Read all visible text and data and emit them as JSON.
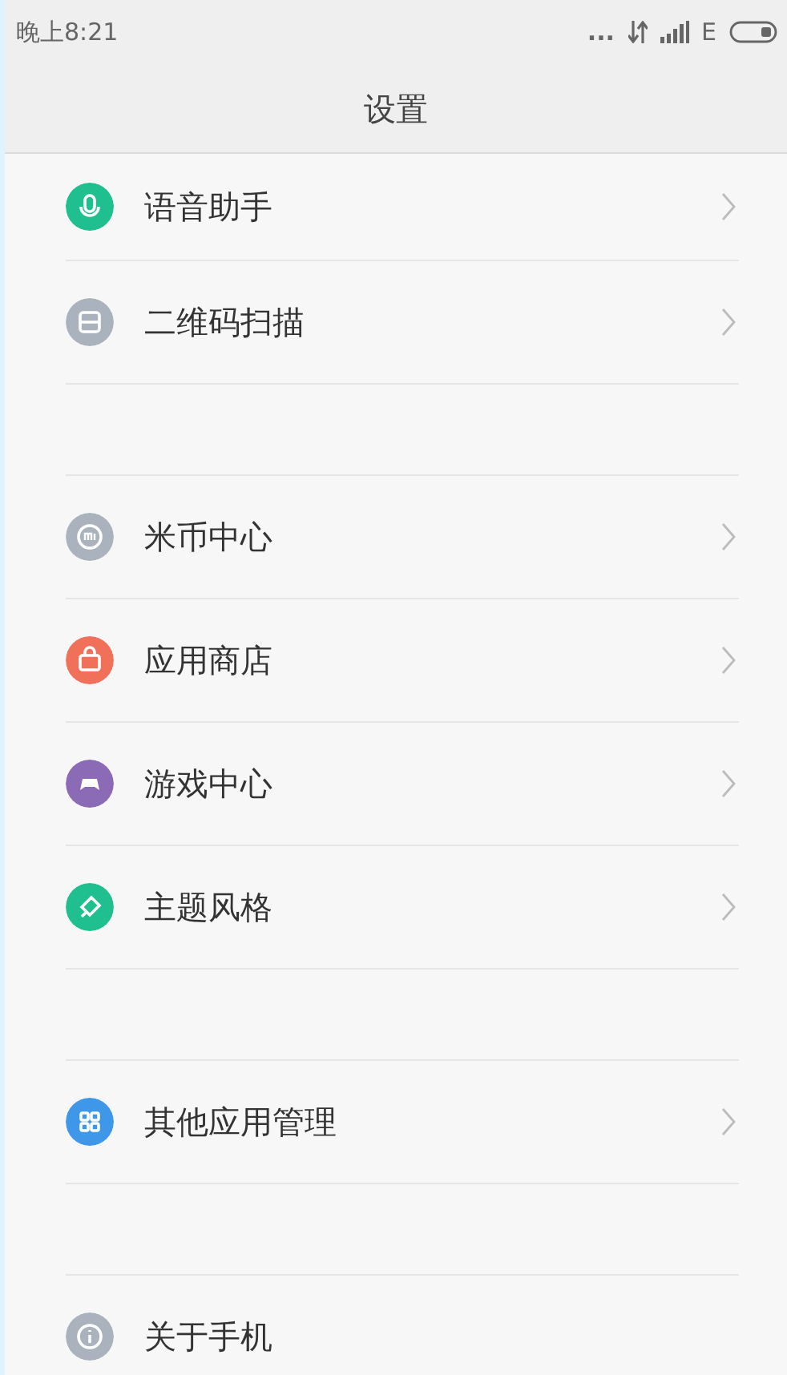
{
  "status_bar": {
    "time": "晚上8:21",
    "dots": "...",
    "network": "E"
  },
  "header": {
    "title": "设置"
  },
  "groups": [
    {
      "items": [
        {
          "label": "语音助手",
          "kind": "mic",
          "color": "#1fbf8f",
          "arrow": true
        },
        {
          "label": "二维码扫描",
          "kind": "scan",
          "color": "#aab3bd",
          "arrow": true
        }
      ]
    },
    {
      "items": [
        {
          "label": "米币中心",
          "kind": "coin",
          "color": "#aab3bd",
          "arrow": true
        },
        {
          "label": "应用商店",
          "kind": "bag",
          "color": "#f0705a",
          "arrow": true
        },
        {
          "label": "游戏中心",
          "kind": "gamepad",
          "color": "#8b6bb5",
          "arrow": true
        },
        {
          "label": "主题风格",
          "kind": "brush",
          "color": "#1fbf8f",
          "arrow": true
        }
      ]
    },
    {
      "items": [
        {
          "label": "其他应用管理",
          "kind": "grid",
          "color": "#3f97ea",
          "arrow": true
        }
      ]
    },
    {
      "items": [
        {
          "label": "关于手机",
          "kind": "info",
          "color": "#aab3bd",
          "arrow": false
        }
      ]
    }
  ]
}
